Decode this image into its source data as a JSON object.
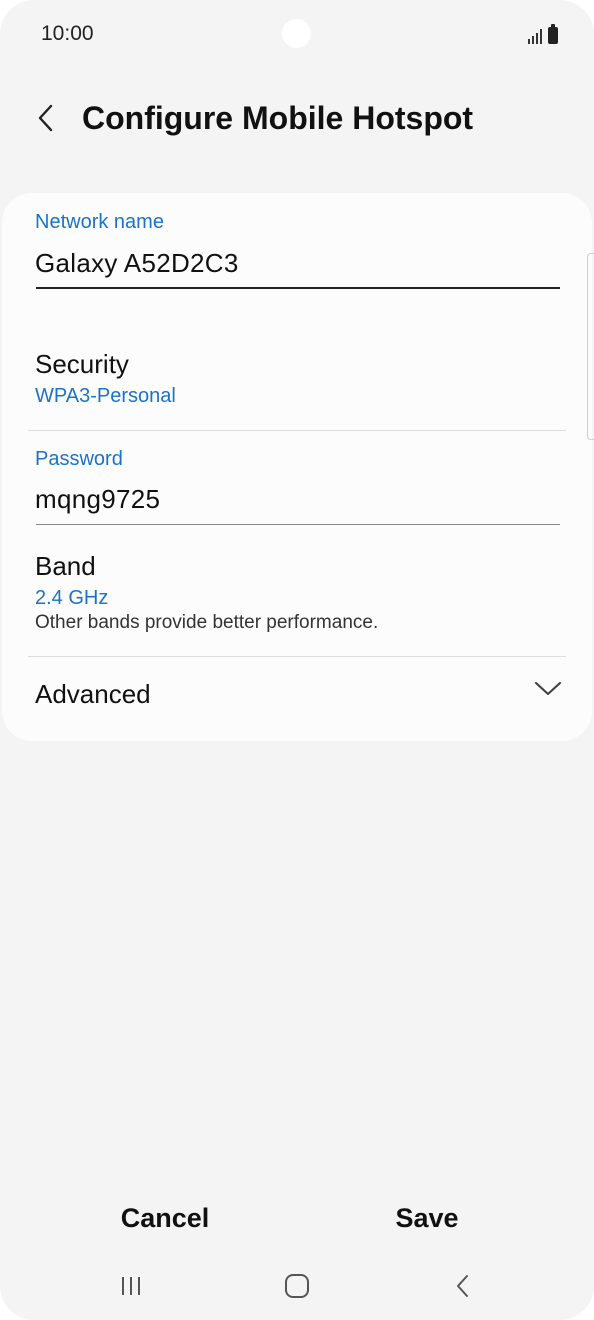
{
  "status_bar": {
    "time": "10:00"
  },
  "header": {
    "back_icon": "chevron-left-icon",
    "title": "Configure Mobile Hotspot"
  },
  "form": {
    "network_name": {
      "label": "Network name",
      "value": "Galaxy A52D2C3"
    },
    "security": {
      "title": "Security",
      "value": "WPA3-Personal"
    },
    "password": {
      "label": "Password",
      "value": "mqng9725"
    },
    "band": {
      "title": "Band",
      "value": "2.4 GHz",
      "description": "Other bands provide better performance."
    },
    "advanced": {
      "title": "Advanced",
      "icon": "chevron-down-icon"
    }
  },
  "actions": {
    "cancel_label": "Cancel",
    "save_label": "Save"
  },
  "navigation": {
    "recents_icon": "recents-icon",
    "home_icon": "home-icon",
    "back_icon": "back-icon"
  },
  "colors": {
    "accent": "#1a73c7",
    "background": "#f4f4f4",
    "card": "#fcfcfc"
  }
}
